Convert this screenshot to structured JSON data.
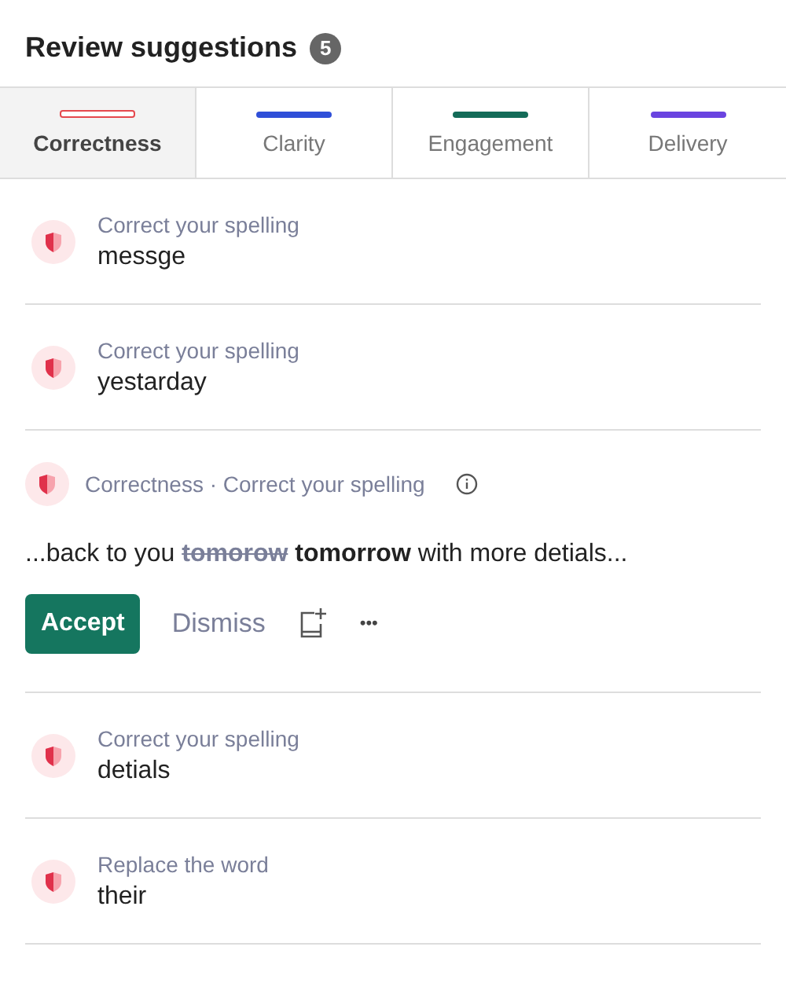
{
  "header": {
    "title": "Review suggestions",
    "count": "5"
  },
  "tabs": [
    {
      "label": "Correctness",
      "selected": true,
      "color": "#e5484d"
    },
    {
      "label": "Clarity",
      "selected": false,
      "color": "#2f4fd8"
    },
    {
      "label": "Engagement",
      "selected": false,
      "color": "#146b58"
    },
    {
      "label": "Delivery",
      "selected": false,
      "color": "#6a44e0"
    }
  ],
  "suggestions": [
    {
      "kind": "collapsed",
      "category": "Correct your spelling",
      "word": "messge"
    },
    {
      "kind": "collapsed",
      "category": "Correct your spelling",
      "word": "yestarday"
    },
    {
      "kind": "expanded",
      "category": "Correctness · Correct your spelling",
      "before": "...back to you",
      "removed": "tomorow",
      "inserted": "tomorrow",
      "after": "with more detials...",
      "accept": "Accept",
      "dismiss": "Dismiss",
      "more": "•••"
    },
    {
      "kind": "collapsed",
      "category": "Correct your spelling",
      "word": "detials"
    },
    {
      "kind": "collapsed",
      "category": "Replace the word",
      "word": "their"
    }
  ]
}
